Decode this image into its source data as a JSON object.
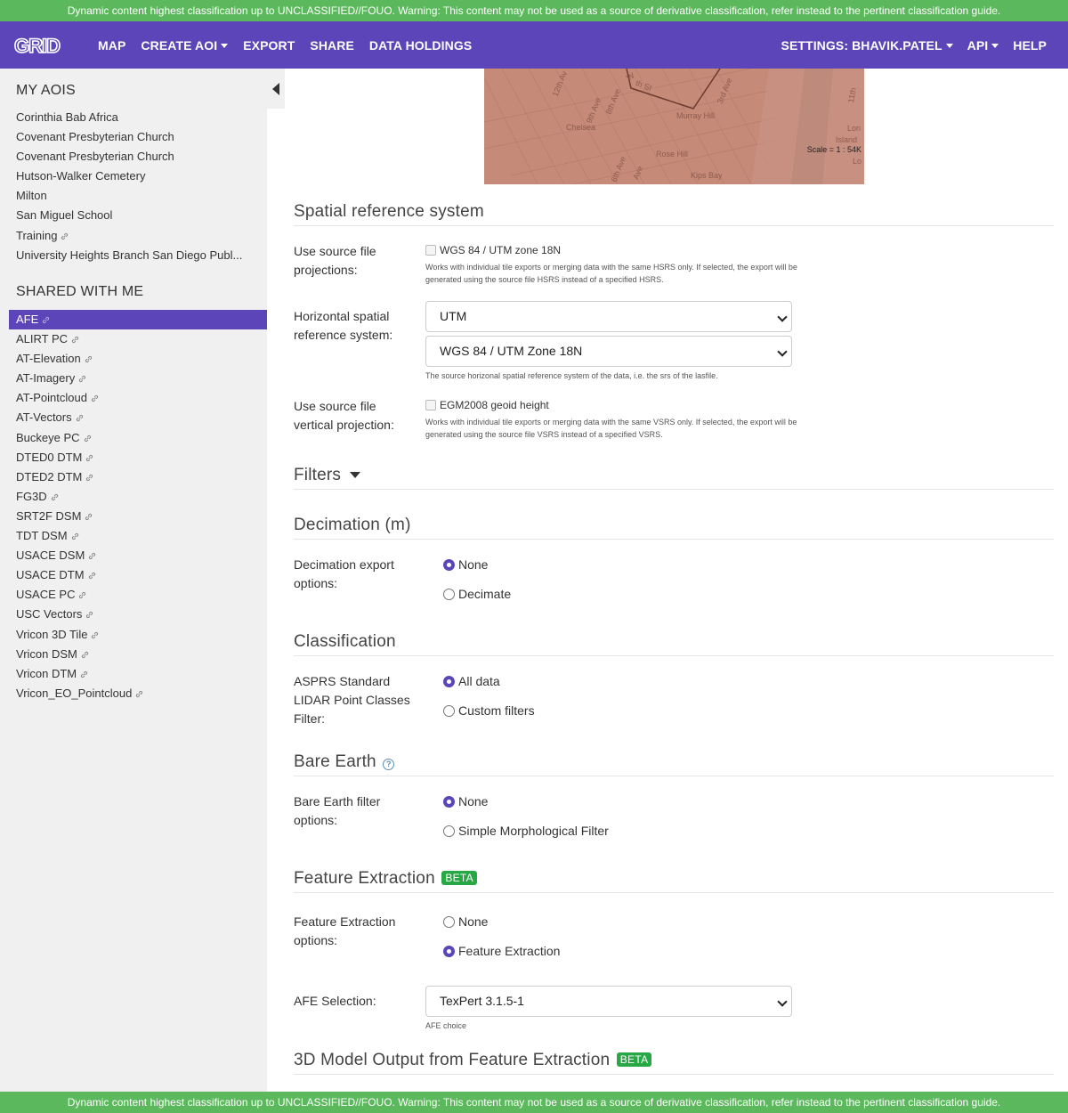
{
  "banner": {
    "text": "Dynamic content highest classification up to UNCLASSIFIED//FOUO. Warning: This content may not be used as a source of derivative classification, refer instead to the pertinent classification guide."
  },
  "nav": {
    "logo": "GRID",
    "map": "MAP",
    "create_aoi": "CREATE AOI",
    "export": "EXPORT",
    "share": "SHARE",
    "data_holdings": "DATA HOLDINGS",
    "settings": "SETTINGS: BHAVIK.PATEL",
    "api": "API",
    "help": "HELP"
  },
  "sidebar": {
    "my_aois_title": "MY AOIS",
    "my_aois": [
      {
        "label": "Corinthia Bab Africa",
        "shared": false
      },
      {
        "label": "Covenant Presbyterian Church",
        "shared": false
      },
      {
        "label": "Covenant Presbyterian Church",
        "shared": false
      },
      {
        "label": "Hutson-Walker Cemetery",
        "shared": false
      },
      {
        "label": "Milton",
        "shared": false
      },
      {
        "label": "San Miguel School",
        "shared": false
      },
      {
        "label": "Training",
        "shared": true
      },
      {
        "label": "University Heights Branch San Diego Publ...",
        "shared": false
      }
    ],
    "shared_title": "SHARED WITH ME",
    "shared": [
      {
        "label": "AFE",
        "active": true
      },
      {
        "label": "ALIRT PC"
      },
      {
        "label": "AT-Elevation"
      },
      {
        "label": "AT-Imagery"
      },
      {
        "label": "AT-Pointcloud"
      },
      {
        "label": "AT-Vectors"
      },
      {
        "label": "Buckeye PC"
      },
      {
        "label": "DTED0 DTM"
      },
      {
        "label": "DTED2 DTM"
      },
      {
        "label": "FG3D"
      },
      {
        "label": "SRT2F DSM"
      },
      {
        "label": "TDT DSM"
      },
      {
        "label": "USACE DSM"
      },
      {
        "label": "USACE DTM"
      },
      {
        "label": "USACE PC"
      },
      {
        "label": "USC Vectors"
      },
      {
        "label": "Vricon 3D Tile"
      },
      {
        "label": "Vricon DSM"
      },
      {
        "label": "Vricon DTM"
      },
      {
        "label": "Vricon_EO_Pointcloud"
      }
    ]
  },
  "map": {
    "labels": [
      "12th Av",
      "9th Ave",
      "8th Ave",
      "W",
      "th St",
      "3rd Ave",
      "Murray Hill",
      "Chelsea",
      "Rose Hill",
      "6th Ave",
      "Ave",
      "Kips Bay",
      "11th",
      "Lon",
      "Island",
      "Lo"
    ],
    "scale": "Scale = 1 : 54K"
  },
  "srs": {
    "title": "Spatial reference system",
    "source_proj_label": "Use source file projections:",
    "source_proj_checkbox": "WGS 84 / UTM zone 18N",
    "source_proj_help": "Works with individual tile exports or merging data with the same HSRS only. If selected, the export will be generated using the source file HSRS instead of a specified HSRS.",
    "horizontal_label": "Horizontal spatial reference system:",
    "horizontal_select_1": "UTM",
    "horizontal_select_2": "WGS 84 / UTM Zone 18N",
    "horizontal_help": "The source horizonal spatial reference system of the data, i.e. the srs of the lasfile.",
    "vertical_label": "Use source file vertical projection:",
    "vertical_checkbox": "EGM2008 geoid height",
    "vertical_help": "Works with individual tile exports or merging data with the same VSRS only. If selected, the export will be generated using the source file VSRS instead of a specified VSRS."
  },
  "filters": {
    "title": "Filters"
  },
  "decimation": {
    "title": "Decimation (m)",
    "label": "Decimation export options:",
    "options": [
      "None",
      "Decimate"
    ],
    "selected": "None"
  },
  "classification": {
    "title": "Classification",
    "label": "ASPRS Standard LIDAR Point Classes Filter:",
    "options": [
      "All data",
      "Custom filters"
    ],
    "selected": "All data"
  },
  "bare_earth": {
    "title": "Bare Earth",
    "help_icon": "?",
    "label": "Bare Earth filter options:",
    "options": [
      "None",
      "Simple Morphological Filter"
    ],
    "selected": "None"
  },
  "feature_extraction": {
    "title": "Feature Extraction",
    "badge": "BETA",
    "label": "Feature Extraction options:",
    "options": [
      "None",
      "Feature Extraction"
    ],
    "selected": "Feature Extraction",
    "afe_label": "AFE Selection:",
    "afe_value": "TexPert 3.1.5-1",
    "afe_help": "AFE choice"
  },
  "model_output": {
    "title": "3D Model Output from Feature Extraction",
    "badge": "BETA"
  },
  "colors": {
    "accent": "#5b45b8",
    "banner": "#5cb85c",
    "beta_badge": "#28a745"
  }
}
